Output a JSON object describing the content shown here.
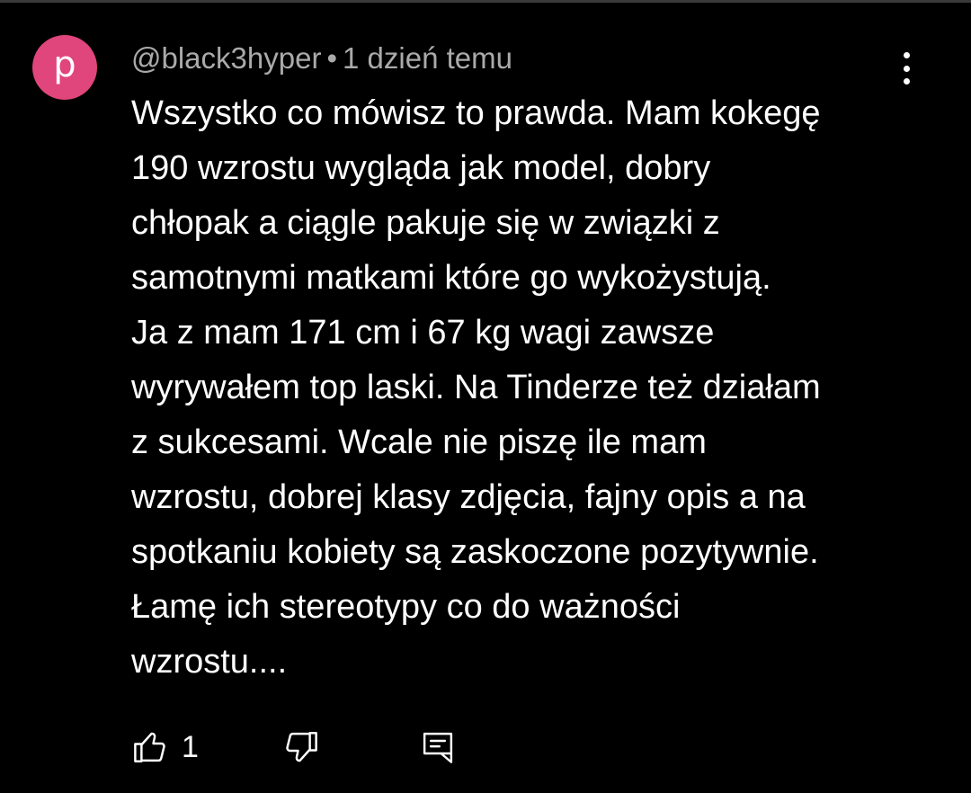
{
  "colors": {
    "background": "#000000",
    "avatar": "#e0457b",
    "text": "#ffffff",
    "meta_text": "#aaaaaa"
  },
  "comment": {
    "avatar_letter": "p",
    "author": "@black3hyper",
    "separator": "•",
    "timestamp": "1 dzień temu",
    "lines": [
      "Wszystko co mówisz to prawda. Mam kokegę",
      "190 wzrostu wygląda jak model, dobry",
      "chłopak a ciągle pakuje się w związki z",
      "samotnymi matkami które go wykożystują.",
      "Ja z mam 171 cm i 67 kg wagi zawsze",
      "wyrywałem top laski. Na Tinderze też działam",
      "z sukcesami. Wcale nie piszę ile mam",
      "wzrostu, dobrej klasy zdjęcia, fajny opis a na",
      "spotkaniu kobiety są zaskoczone pozytywnie.",
      "Łamę ich stereotypy co do ważności",
      "wzrostu...."
    ]
  },
  "actions": {
    "like_icon": "thumbs-up-icon",
    "like_count": "1",
    "dislike_icon": "thumbs-down-icon",
    "reply_icon": "reply-comment-icon",
    "more_icon": "more-vert-icon"
  }
}
